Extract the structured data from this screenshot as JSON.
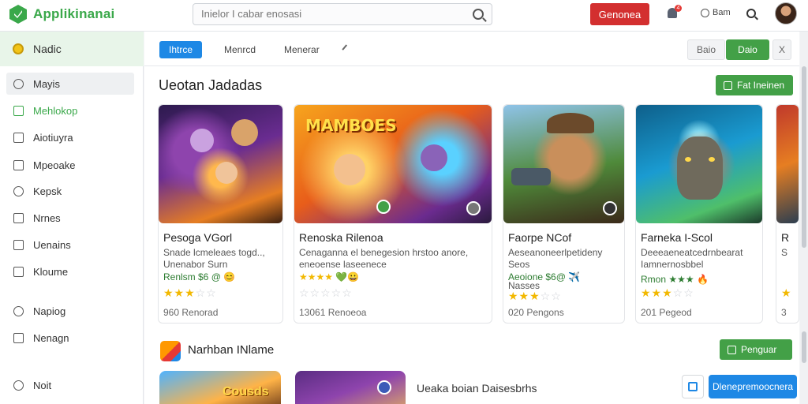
{
  "app": {
    "title": "Applikinanai"
  },
  "header": {
    "search_placeholder": "Inielor I cabar enosasi",
    "primary_button": "Genonea",
    "notification_count": "4",
    "help_label": "Bam"
  },
  "sidebar": {
    "home_label": "Nadic",
    "items": [
      {
        "label": "Mayis",
        "icon": "circle-icon"
      },
      {
        "label": "Mehlokop",
        "icon": "square-icon"
      },
      {
        "label": "Aiotiuyra",
        "icon": "square-icon"
      },
      {
        "label": "Mpeoake",
        "icon": "image-icon"
      },
      {
        "label": "Kepsk",
        "icon": "tag-icon"
      },
      {
        "label": "Nrnes",
        "icon": "square-icon"
      },
      {
        "label": "Uenains",
        "icon": "square-icon"
      },
      {
        "label": "Kloume",
        "icon": "square-icon"
      }
    ],
    "footer_items": [
      {
        "label": "Napiog",
        "icon": "refresh-icon"
      },
      {
        "label": "Nenagn",
        "icon": "list-icon"
      },
      {
        "label": "Noit",
        "icon": "settings-icon"
      }
    ]
  },
  "tabs": [
    {
      "label": "Ihtrce"
    },
    {
      "label": "Menrcd"
    },
    {
      "label": "Menerar"
    }
  ],
  "tab_actions": {
    "secondary": "Baio",
    "primary": "Daio",
    "close": "X"
  },
  "section1": {
    "title": "Ueotan Jadadas",
    "button": "Fat Ineinen",
    "cards": [
      {
        "title": "Pesoga VGorl",
        "desc": "Snade lcmeleaes togd.., Unenabor Surn",
        "tags": "Renlsm $6 @ 😊",
        "stars": "★★★",
        "stars_off": "☆☆",
        "count": "960 Renorad"
      },
      {
        "title": "Renoska Rilenoa",
        "desc": "Cenaganna el benegesion hrstoo anore, eneoense laseenece",
        "tags": "★★★★ 💚😀",
        "stars": "",
        "stars_off": "☆☆☆☆☆",
        "count": "13061 Renoeoa"
      },
      {
        "title": "Faorpe NCof",
        "desc": "Aeseanoneerlpetideny Seos",
        "tags": "Aeoione $6@ ✈️",
        "extra": "Nasses",
        "stars": "★★★",
        "stars_off": "☆☆",
        "count": "020 Pengons"
      },
      {
        "title": "Farneka I-Scol",
        "desc": "Deeeaeneatcedrnbearat Iamnernosbbel",
        "tags": "Rmon ★★★ 🔥",
        "stars": "★★★",
        "stars_off": "☆☆",
        "count": "201 Pegeod"
      },
      {
        "title": "R",
        "desc": "S",
        "tags": "",
        "stars": "★",
        "stars_off": "",
        "count": "3"
      }
    ]
  },
  "section2": {
    "title": "Narhban INlame",
    "button": "Penguar",
    "item_text": "Ueaka boian Daisesbrhs"
  },
  "fab": {
    "label": "Dlenepremoocnera"
  },
  "colors": {
    "brand": "#3aa84a",
    "accent_blue": "#1e88e5",
    "danger": "#d32f2f"
  }
}
